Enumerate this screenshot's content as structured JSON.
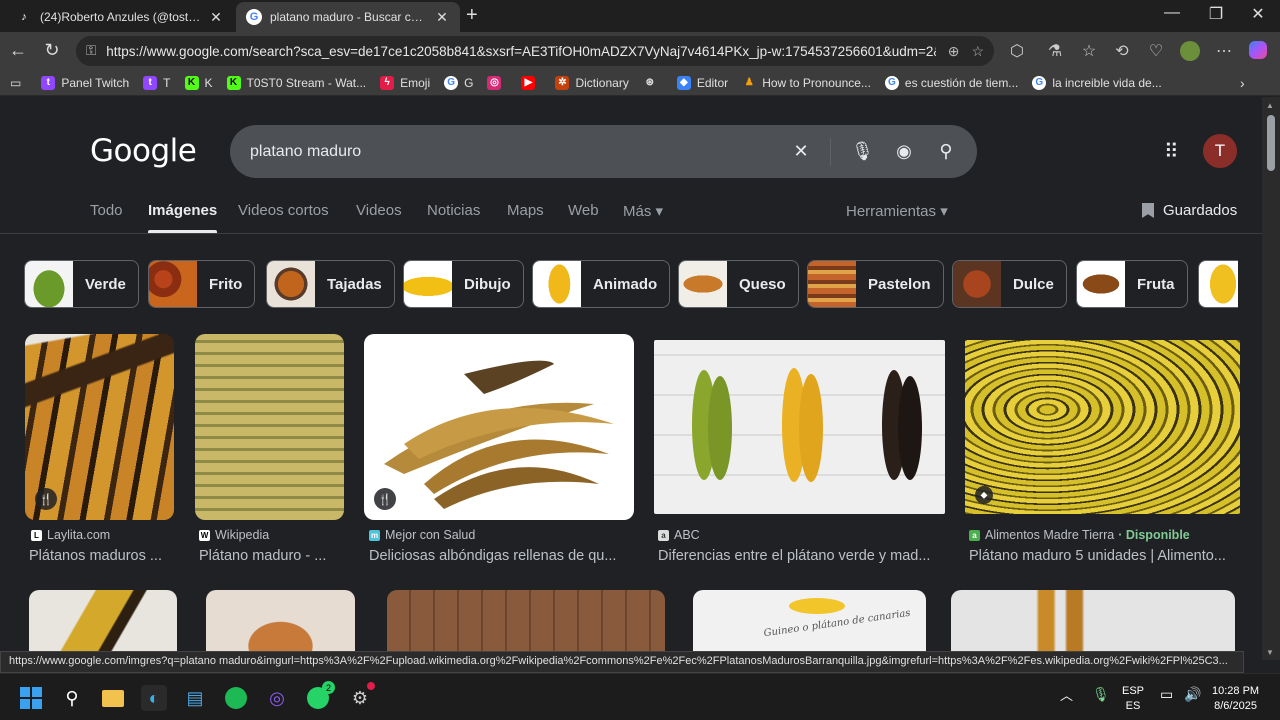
{
  "browser": {
    "tabs": [
      {
        "title": "(24)Roberto Anzules (@tosto210)",
        "icon": "tiktok-icon"
      },
      {
        "title": "platano maduro - Buscar con Goo",
        "icon": "google-icon",
        "active": true
      }
    ],
    "url": "https://www.google.com/search?sca_esv=de17ce1c2058b841&sxsrf=AE3TifOH0mADZX7VyNaj7v4614PKx_jp-w:1754537256601&udm=2&fb...",
    "bookmarks": [
      "Panel Twitch",
      "T",
      "K",
      "T0ST0 Stream - Wat...",
      "Emoji",
      "G",
      "",
      "",
      "Dictionary",
      "",
      "Editor",
      "How to Pronounce...",
      "es cuestión de tiem...",
      "la increible vida de..."
    ]
  },
  "google": {
    "logo": "Google",
    "query": "platano maduro",
    "avatar_letter": "T",
    "nav_tabs": [
      "Todo",
      "Imágenes",
      "Videos cortos",
      "Videos",
      "Noticias",
      "Maps",
      "Web",
      "Más ▾"
    ],
    "active_tab": "Imágenes",
    "tools": "Herramientas ▾",
    "saved": "Guardados",
    "chips": [
      "Verde",
      "Frito",
      "Tajadas",
      "Dibujo",
      "Animado",
      "Queso",
      "Pastelon",
      "Dulce",
      "Fruta"
    ],
    "results": [
      {
        "source": "Laylita.com",
        "title": "Plátanos maduros ..."
      },
      {
        "source": "Wikipedia",
        "title": "Plátano maduro - ..."
      },
      {
        "source": "Mejor con Salud",
        "title": "Deliciosas albóndigas rellenas de qu..."
      },
      {
        "source": "ABC",
        "title": "Diferencias entre el plátano verde y mad..."
      },
      {
        "source": "Alimentos Madre Tierra",
        "availability": "· Disponible",
        "title": "Plátano maduro 5 unidades | Alimento..."
      }
    ],
    "row2_caption": "Guineo o plátano de canarias"
  },
  "status_url": "https://www.google.com/imgres?q=platano maduro&imgurl=https%3A%2F%2Fupload.wikimedia.org%2Fwikipedia%2Fcommons%2Fe%2Fec%2FPlatanosMadurosBarranquilla.jpg&imgrefurl=https%3A%2F%2Fes.wikipedia.org%2Fwiki%2FPl%25C3...",
  "taskbar": {
    "lang": "ESP",
    "lang2": "ES",
    "time": "10:28 PM",
    "date": "8/6/2025",
    "whatsapp_badge": "2"
  },
  "colors": {
    "accent": "#8ab4f8",
    "available": "#81c995",
    "avatar": "#8b2e2a"
  }
}
